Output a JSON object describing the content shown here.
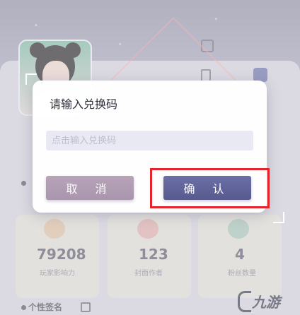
{
  "dialog": {
    "title": "请输入兑换码",
    "input_placeholder": "点击输入兑换码",
    "input_value": "",
    "cancel_label": "取 消",
    "confirm_label": "确 认"
  },
  "background": {
    "stats": [
      {
        "value": "79208",
        "label": "玩家影响力"
      },
      {
        "value": "123",
        "label": "封面作者"
      },
      {
        "value": "4",
        "label": "粉丝数量"
      }
    ],
    "signature_label": "个性签名",
    "watermark": "九游"
  },
  "colors": {
    "confirm": "#5d6097",
    "cancel": "#ae9bb1",
    "highlight": "#e3242b"
  }
}
